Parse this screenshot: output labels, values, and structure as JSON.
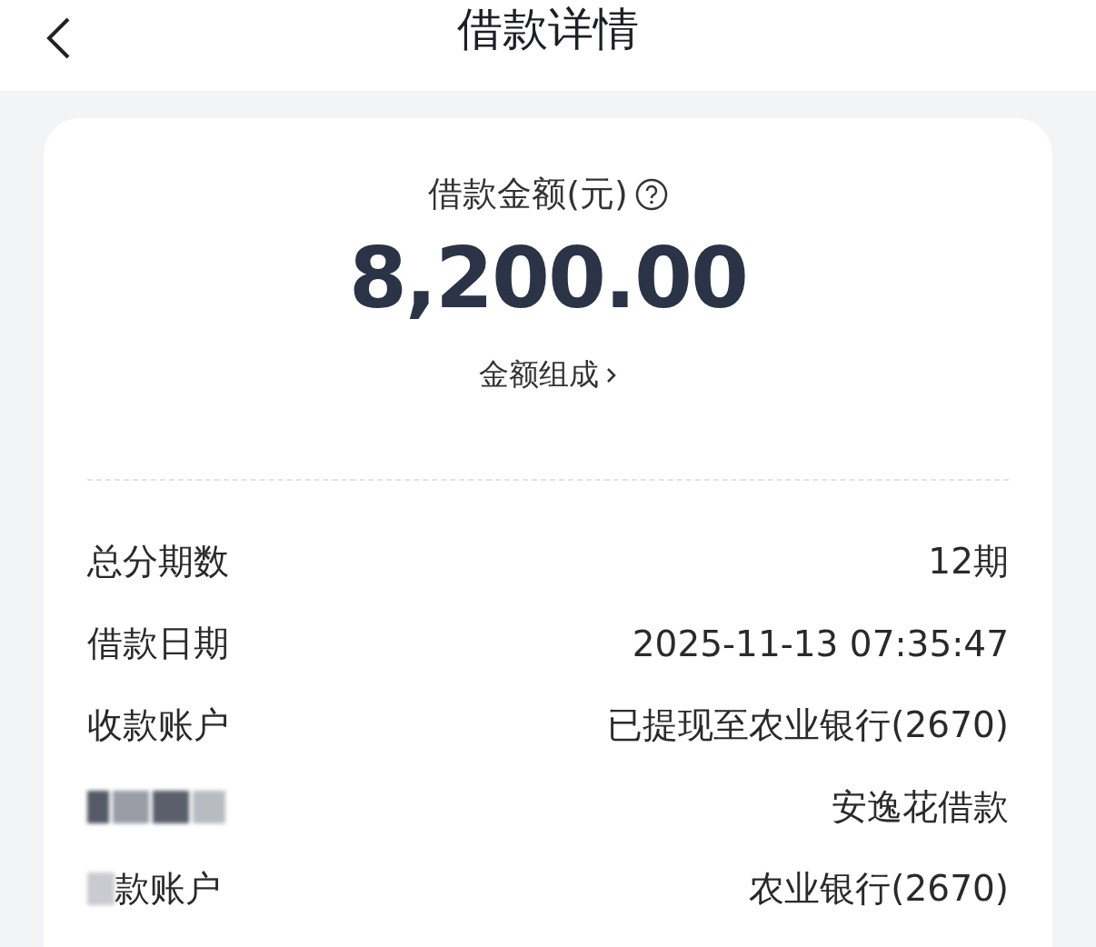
{
  "header": {
    "title": "借款详情"
  },
  "summary": {
    "label": "借款金额(元)",
    "amount": "8,200.00",
    "breakdown_link": "金额组成"
  },
  "rows": [
    {
      "kind": "plain",
      "label": "总分期数",
      "value": "12期"
    },
    {
      "kind": "plain",
      "label": "借款日期",
      "value": "2025-11-13 07:35:47"
    },
    {
      "kind": "plain",
      "label": "收款账户",
      "value": "已提现至农业银行(2670)"
    },
    {
      "kind": "redacted",
      "value": "安逸花借款"
    },
    {
      "kind": "partly-redacted",
      "label": "款账户",
      "value": "农业银行(2670)"
    }
  ]
}
